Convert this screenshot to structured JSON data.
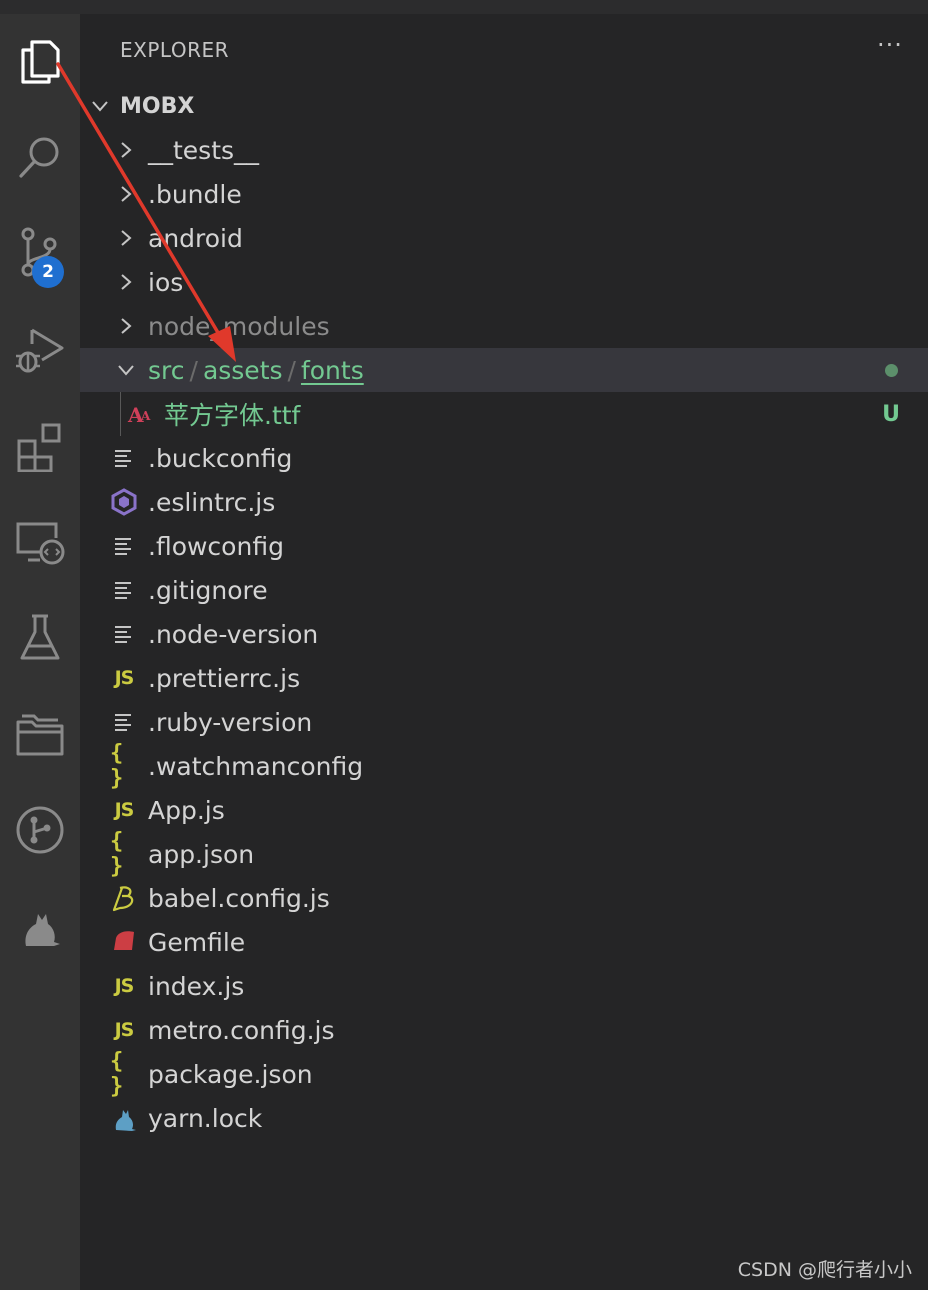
{
  "activity_bar": {
    "items": [
      {
        "icon": "files-icon",
        "active": true
      },
      {
        "icon": "search-icon"
      },
      {
        "icon": "source-control-icon",
        "badge": "2"
      },
      {
        "icon": "run-debug-icon"
      },
      {
        "icon": "extensions-icon"
      },
      {
        "icon": "remote-explorer-icon"
      },
      {
        "icon": "testing-icon"
      },
      {
        "icon": "project-manager-icon"
      },
      {
        "icon": "git-graph-icon"
      },
      {
        "icon": "yarn-cat-icon"
      }
    ]
  },
  "explorer": {
    "title": "EXPLORER",
    "more_actions": "···",
    "root_folder": "MOBX",
    "folders": [
      {
        "name": "__tests__",
        "expanded": false
      },
      {
        "name": ".bundle",
        "expanded": false
      },
      {
        "name": "android",
        "expanded": false
      },
      {
        "name": "ios",
        "expanded": false
      },
      {
        "name": "node_modules",
        "expanded": false,
        "dimmed": true
      }
    ],
    "compact_folder": {
      "parts": [
        "src",
        "assets",
        "fonts"
      ],
      "separator": "/",
      "expanded": true,
      "selected": true
    },
    "font_file": {
      "name": "苹方字体.ttf",
      "icon": "font-icon",
      "status": "U"
    },
    "files": [
      {
        "name": ".buckconfig",
        "icon": "lines-icon"
      },
      {
        "name": ".eslintrc.js",
        "icon": "eslint-icon"
      },
      {
        "name": ".flowconfig",
        "icon": "lines-icon"
      },
      {
        "name": ".gitignore",
        "icon": "lines-icon"
      },
      {
        "name": ".node-version",
        "icon": "lines-icon"
      },
      {
        "name": ".prettierrc.js",
        "icon": "js-icon"
      },
      {
        "name": ".ruby-version",
        "icon": "lines-icon"
      },
      {
        "name": ".watchmanconfig",
        "icon": "json-icon"
      },
      {
        "name": "App.js",
        "icon": "js-icon"
      },
      {
        "name": "app.json",
        "icon": "json-icon"
      },
      {
        "name": "babel.config.js",
        "icon": "babel-icon"
      },
      {
        "name": "Gemfile",
        "icon": "ruby-icon"
      },
      {
        "name": "index.js",
        "icon": "js-icon"
      },
      {
        "name": "metro.config.js",
        "icon": "js-icon"
      },
      {
        "name": "package.json",
        "icon": "json-icon"
      },
      {
        "name": "yarn.lock",
        "icon": "yarn-icon"
      }
    ]
  },
  "icon_glyphs": {
    "js": "JS",
    "json": "{ }",
    "font": "A"
  },
  "watermark": "CSDN @爬行者小小",
  "colors": {
    "activity_bar": "#333333",
    "sidebar": "#252526",
    "selected_row": "#37373d",
    "untracked_green": "#73c991",
    "badge_blue": "#1f6fd0",
    "annotation_arrow": "#e0392b"
  }
}
